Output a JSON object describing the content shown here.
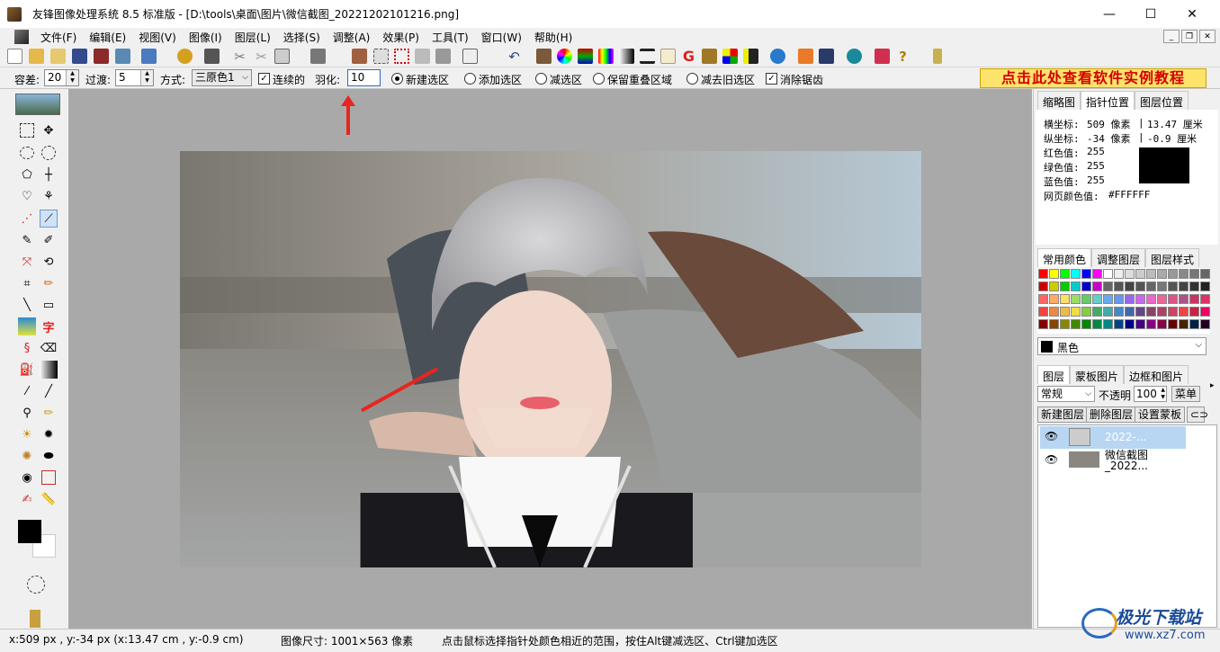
{
  "window": {
    "title": "友锋图像处理系统 8.5 标准版 - [D:\\tools\\桌面\\图片\\微信截图_20221202101216.png]",
    "minimize": "—",
    "maximize": "☐",
    "close": "✕"
  },
  "menu": {
    "items": [
      "文件(F)",
      "编辑(E)",
      "视图(V)",
      "图像(I)",
      "图层(L)",
      "选择(S)",
      "调整(A)",
      "效果(P)",
      "工具(T)",
      "窗口(W)",
      "帮助(H)"
    ]
  },
  "options": {
    "tolerance_label": "容差:",
    "tolerance_value": "20",
    "filter_label": "过渡:",
    "filter_value": "5",
    "mode_label": "方式:",
    "mode_value": "三原色1",
    "contiguous_label": "连续的",
    "contiguous_checked": "✓",
    "feather_label": "羽化:",
    "feather_value": "10",
    "radio_new": "新建选区",
    "radio_add": "添加选区",
    "radio_subtract": "减选区",
    "radio_intersect": "保留重叠区域",
    "radio_remove_old": "减去旧选区",
    "antialias_label": "消除锯齿",
    "antialias_checked": "✓",
    "tutorial_banner": "点击此处查看软件实例教程"
  },
  "info_panel": {
    "tabs": [
      "缩略图",
      "指针位置",
      "图层位置"
    ],
    "active_tab": "指针位置",
    "x_label": "横坐标:",
    "x_px": "509 像素",
    "x_cm": "13.47 厘米",
    "y_label": "纵坐标:",
    "y_px": "-34 像素",
    "y_cm": "-0.9 厘米",
    "red_label": "红色值:",
    "red_value": "255",
    "green_label": "绿色值:",
    "green_value": "255",
    "blue_label": "蓝色值:",
    "blue_value": "255",
    "web_label": "网页颜色值:",
    "web_value": "#FFFFFF",
    "sep": "|"
  },
  "color_panel": {
    "tabs": [
      "常用颜色",
      "调整图层",
      "图层样式"
    ],
    "selected_color_name": "黑色"
  },
  "layers_panel": {
    "tabs": [
      "图层",
      "蒙板图片",
      "边框和图片"
    ],
    "blend_mode": "常规",
    "opacity_label": "不透明",
    "opacity_value": "100",
    "menu_button": "菜单",
    "new_layer": "新建图层",
    "delete_layer": "删除图层",
    "set_mask": "设置蒙板",
    "layers": [
      {
        "name": "2022-...",
        "selected": true
      },
      {
        "name": "微信截图\n_2022...",
        "selected": false
      }
    ]
  },
  "status": {
    "coords": "x:509 px , y:-34 px (x:13.47 cm , y:-0.9 cm)",
    "image_size": "图像尺寸: 1001×563 像素",
    "hint": "点击鼠标选择指针处颜色相近的范围，按住Alt键减选区、Ctrl键加选区",
    "watermark": "极光下载站",
    "watermark_url": "www.xz7.com"
  },
  "colors": {
    "accent_red": "#e8251f",
    "tutorial_bg": "#fde36a",
    "workspace_gray": "#a9a9a9"
  }
}
